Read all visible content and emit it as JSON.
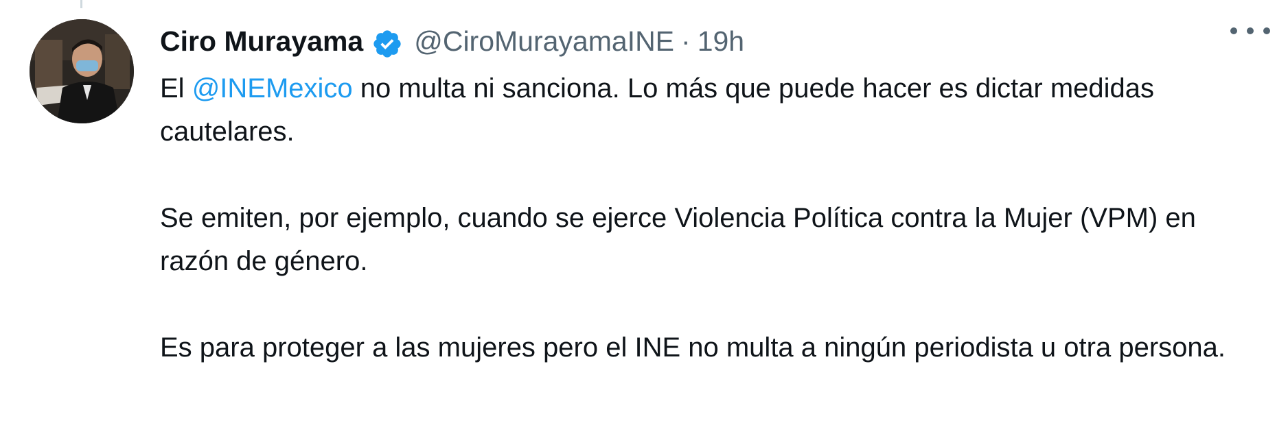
{
  "tweet": {
    "author": {
      "display_name": "Ciro Murayama",
      "handle": "@CiroMurayamaINE",
      "verified": true,
      "avatar_icon": "profile-photo"
    },
    "separator": "·",
    "timestamp": "19h",
    "more_icon": "more-horizontal-icon",
    "paragraphs": [
      {
        "prefix": "El ",
        "mention": "@INEMexico",
        "suffix": " no multa ni sanciona. Lo más que puede hacer es dictar medidas cautelares."
      },
      {
        "text": "Se emiten, por ejemplo, cuando se ejerce Violencia Política contra la Mujer (VPM) en razón de género."
      },
      {
        "text": "Es para proteger a las mujeres pero el INE no multa a ningún periodista u otra persona."
      }
    ]
  },
  "colors": {
    "text": "#0f1419",
    "secondary": "#536471",
    "link": "#1d9bf0",
    "verified_badge": "#1d9bf0"
  }
}
